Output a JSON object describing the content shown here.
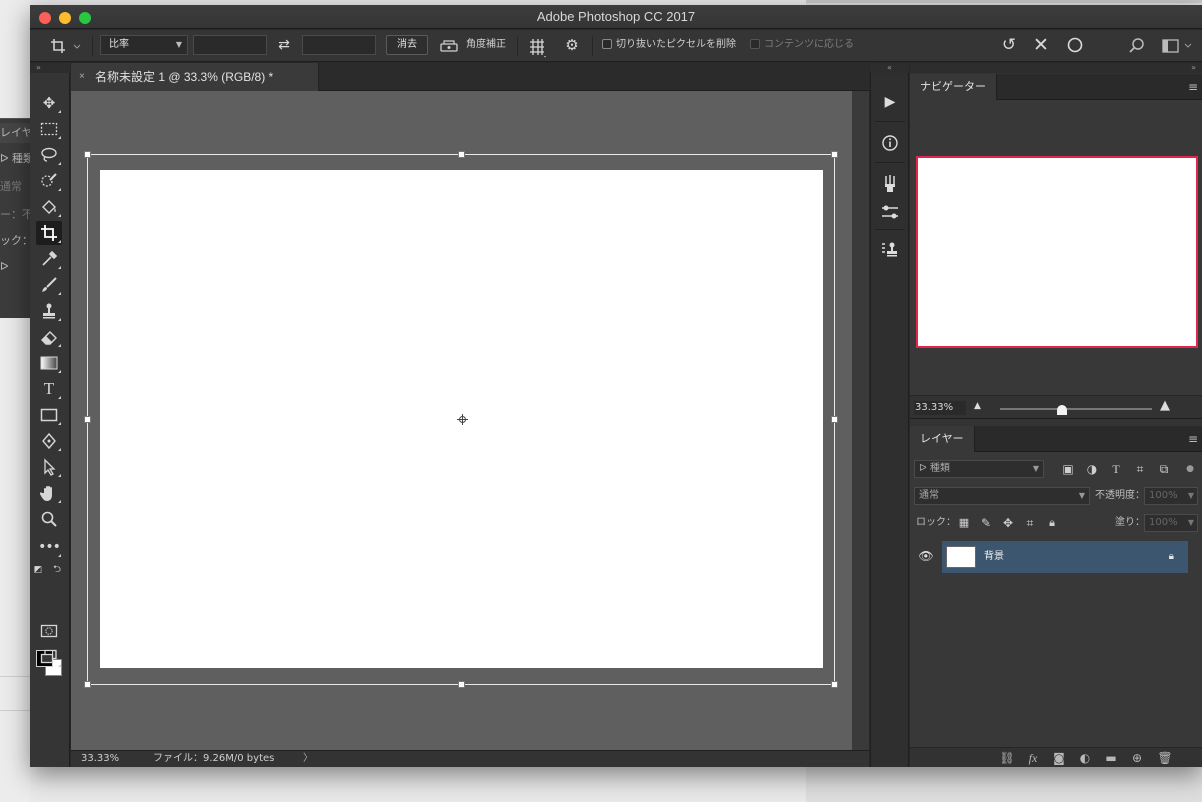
{
  "window": {
    "title": "Adobe Photoshop CC 2017"
  },
  "options_bar": {
    "ratio_label": "比率",
    "width_value": "",
    "height_value": "",
    "clear_label": "消去",
    "straighten_label": "角度補正",
    "delete_cropped_label": "切り抜いたピクセルを削除",
    "delete_cropped_checked": false,
    "content_aware_label": "コンテンツに応じる",
    "content_aware_checked": false
  },
  "background_panel": {
    "rows": [
      "レイヤー",
      "ᐅ 種類",
      "通常",
      "ー：不",
      "ック：",
      "ᐅ"
    ]
  },
  "document": {
    "tab_title": "名称未設定 1 @ 33.3% (RGB/8) *",
    "close_glyph": "×",
    "fill_color": "#ffffff",
    "pasteboard_color": "#5f5f5f"
  },
  "status": {
    "zoom": "33.33%",
    "file_info": "ファイル：9.26M/0 bytes",
    "arrow": "〉"
  },
  "toolbox": {
    "icons": [
      "move-icon",
      "marquee-icon",
      "lasso-icon",
      "quick-select-icon",
      "paint-bucket-icon",
      "crop-icon",
      "eyedropper-icon",
      "brush-icon",
      "stamp-icon",
      "eraser-icon",
      "gradient-icon",
      "type-icon",
      "rectangle-icon",
      "pen-icon",
      "path-select-icon",
      "hand-icon",
      "zoom-icon",
      "more-tools-icon"
    ],
    "active_tool": "crop-icon",
    "foreground_color": "#000000",
    "background_color": "#ffffff"
  },
  "dock": {
    "icons": [
      "play-icon",
      "info-icon",
      "brush-settings-icon",
      "adjustments-icon",
      "clone-source-icon"
    ]
  },
  "navigator": {
    "tab_label": "ナビゲーター",
    "zoom": "33.33%",
    "view_box_color": "#e0254f"
  },
  "layers": {
    "tab_label": "レイヤー",
    "filter_label": "ᐅ 種類",
    "blend_mode": "通常",
    "opacity_label": "不透明度：",
    "opacity_value": "100%",
    "lock_label": "ロック：",
    "fill_label": "塗り：",
    "fill_value": "100%",
    "items": [
      {
        "name": "背景",
        "visible": true,
        "locked": true,
        "selected": true
      }
    ]
  }
}
